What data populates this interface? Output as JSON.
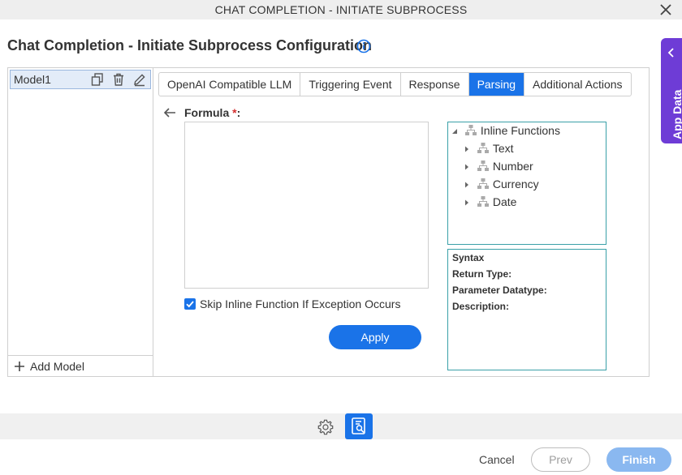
{
  "window": {
    "title": "CHAT COMPLETION - INITIATE SUBPROCESS"
  },
  "page": {
    "title": "Chat Completion - Initiate Subprocess Configuration"
  },
  "side_tab": {
    "label": "App Data"
  },
  "models": {
    "items": [
      {
        "label": "Model1"
      }
    ],
    "add_label": "Add Model"
  },
  "tabs": [
    {
      "label": "OpenAI Compatible LLM",
      "active": false
    },
    {
      "label": "Triggering Event",
      "active": false
    },
    {
      "label": "Response",
      "active": false
    },
    {
      "label": "Parsing",
      "active": true
    },
    {
      "label": "Additional Actions",
      "active": false
    }
  ],
  "formula": {
    "label": "Formula",
    "required_mark": "*",
    "label_suffix": ":",
    "value": ""
  },
  "skip_option": {
    "label": "Skip Inline Function If Exception Occurs",
    "checked": true
  },
  "apply_label": "Apply",
  "functions_tree": {
    "root": "Inline Functions",
    "children": [
      "Text",
      "Number",
      "Currency",
      "Date"
    ]
  },
  "syntax_panel": {
    "syntax": "Syntax",
    "return_type": "Return Type:",
    "parameter_datatype": "Parameter Datatype:",
    "description": "Description:"
  },
  "footer": {
    "cancel_label": "Cancel",
    "prev_label": "Prev",
    "finish_label": "Finish"
  },
  "icons": {
    "close": "close-icon",
    "info": "info-icon",
    "chevron": "chevron-left-icon",
    "copy": "copy-icon",
    "delete": "trash-icon",
    "edit": "pencil-icon",
    "add": "plus-icon",
    "back": "arrow-left-icon",
    "tree_node": "hierarchy-icon",
    "settings": "gear-icon",
    "document": "document-search-icon"
  },
  "colors": {
    "accent": "#1a73e8",
    "side_tab": "#6e3cd6",
    "required": "#d32f2f",
    "tree_border": "#3aa0a8",
    "finish_disabled": "#8ab8f0"
  }
}
